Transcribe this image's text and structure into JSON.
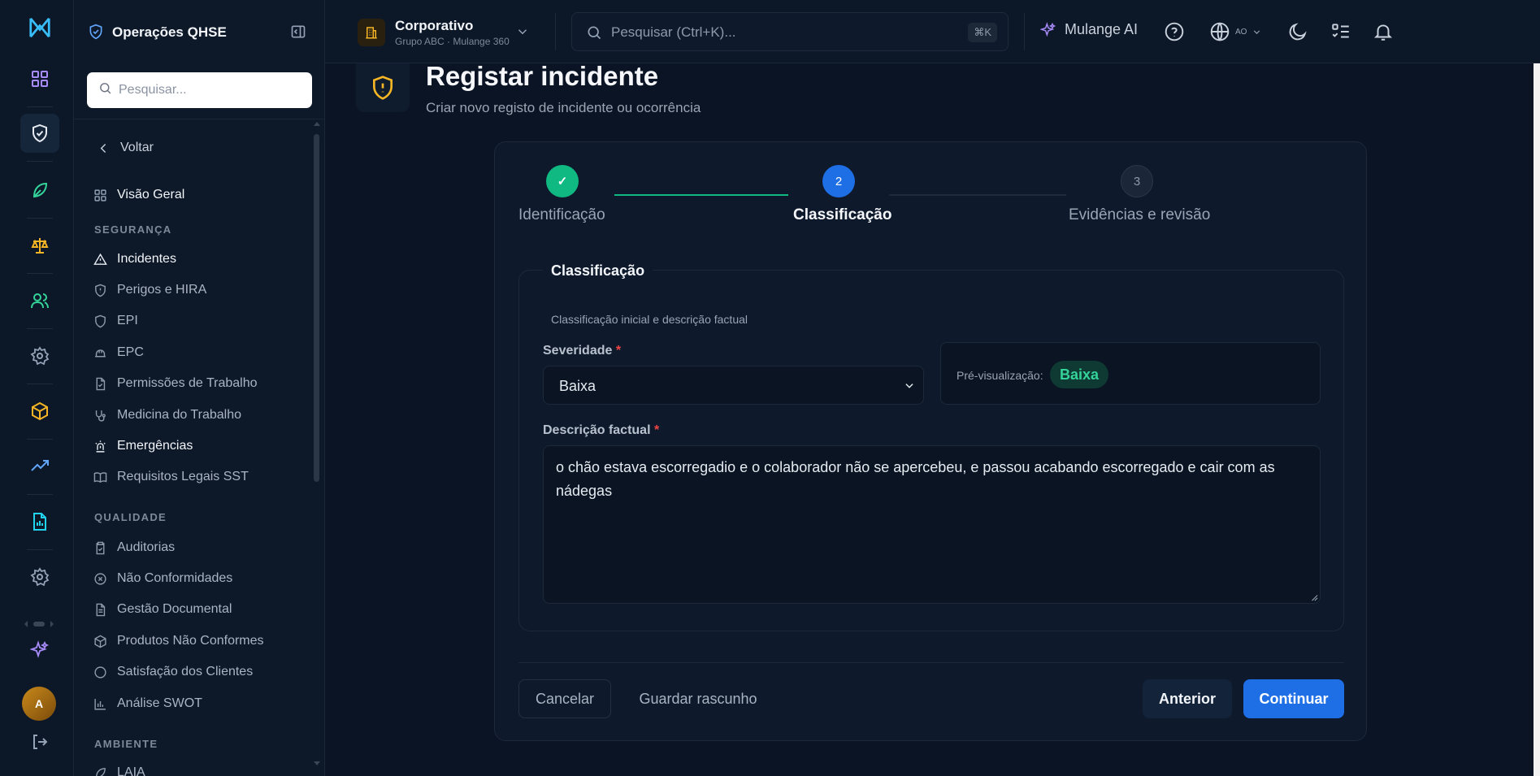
{
  "sidebar": {
    "title": "Operações QHSE",
    "search_placeholder": "Pesquisar...",
    "back_label": "Voltar",
    "overview_label": "Visão Geral",
    "sections": {
      "safety": "SEGURANÇA",
      "quality": "QUALIDADE",
      "environment": "AMBIENTE"
    },
    "safety_items": [
      "Incidentes",
      "Perigos e HIRA",
      "EPI",
      "EPC",
      "Permissões de Trabalho",
      "Medicina do Trabalho",
      "Emergências",
      "Requisitos Legais SST"
    ],
    "quality_items": [
      "Auditorias",
      "Não Conformidades",
      "Gestão Documental",
      "Produtos Não Conformes",
      "Satisfação dos Clientes",
      "Análise SWOT"
    ],
    "environment_items": [
      "LAIA"
    ]
  },
  "rail": {
    "avatar_initial": "A"
  },
  "topbar": {
    "org_name": "Corporativo",
    "org_sub": "Grupo ABC · Mulange 360",
    "search_placeholder": "Pesquisar (Ctrl+K)...",
    "search_shortcut": "⌘K",
    "ai_label": "Mulange AI",
    "language_code": "AO"
  },
  "page": {
    "title": "Registar incidente",
    "subtitle": "Criar novo registo de incidente ou ocorrência"
  },
  "stepper": {
    "steps": [
      {
        "number": "✓",
        "label": "Identificação",
        "state": "done"
      },
      {
        "number": "2",
        "label": "Classificação",
        "state": "current"
      },
      {
        "number": "3",
        "label": "Evidências e revisão",
        "state": "upcoming"
      }
    ]
  },
  "form": {
    "legend": "Classificação",
    "description": "Classificação inicial e descrição factual",
    "severity_label": "Severidade",
    "required_mark": "*",
    "severity_value": "Baixa",
    "preview_label": "Pré-visualização:",
    "preview_badge": "Baixa",
    "factual_label": "Descrição factual",
    "factual_value": "o chão estava escorregadio e o colaborador não se apercebeu, e passou acabando escorregado e cair com as nádegas"
  },
  "actions": {
    "cancel": "Cancelar",
    "draft": "Guardar rascunho",
    "previous": "Anterior",
    "next": "Continuar"
  },
  "colors": {
    "background": "#0b1424",
    "accent_blue": "#1e6fe6",
    "success_green": "#10b981",
    "warning_amber": "#f5b524",
    "required_red": "#ef4444"
  }
}
